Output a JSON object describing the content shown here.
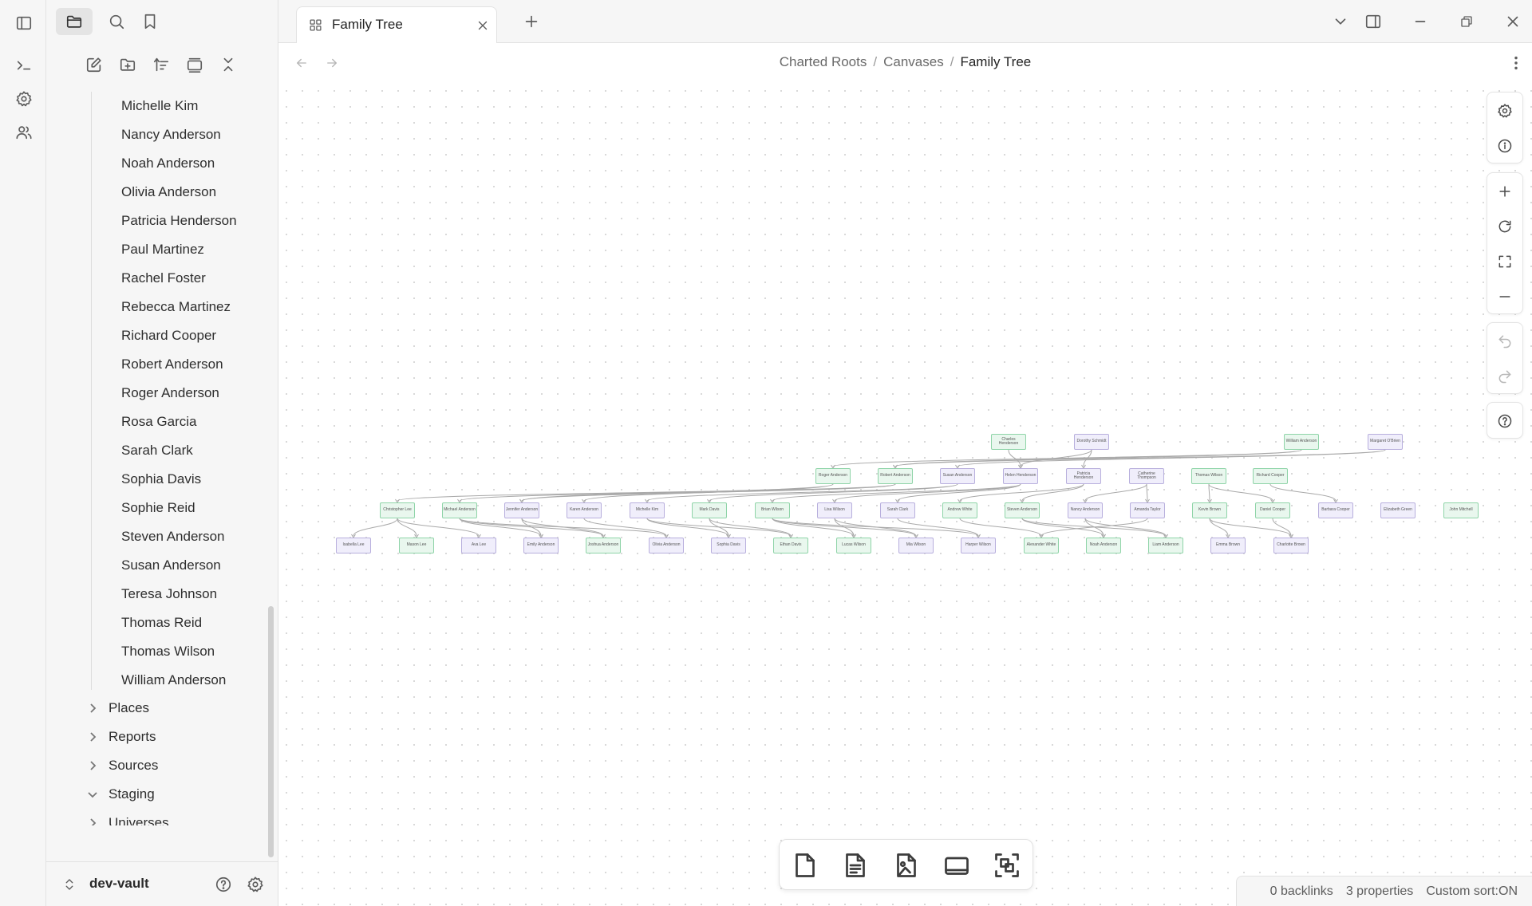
{
  "ribbon": {
    "icons": [
      "sidebar-toggle-icon",
      "terminal-icon",
      "settings-icon",
      "people-icon"
    ]
  },
  "sidebar": {
    "top_icons": [
      "folder-icon",
      "search-icon",
      "bookmark-icon"
    ],
    "toolbar_icons": [
      "new-note-icon",
      "new-folder-icon",
      "sort-icon",
      "collapse-view-icon",
      "collapse-all-icon"
    ],
    "people": [
      "Michelle Kim",
      "Nancy Anderson",
      "Noah Anderson",
      "Olivia Anderson",
      "Patricia Henderson",
      "Paul Martinez",
      "Rachel Foster",
      "Rebecca Martinez",
      "Richard Cooper",
      "Robert Anderson",
      "Roger Anderson",
      "Rosa Garcia",
      "Sarah Clark",
      "Sophia Davis",
      "Sophie Reid",
      "Steven Anderson",
      "Susan Anderson",
      "Teresa Johnson",
      "Thomas Reid",
      "Thomas Wilson",
      "William Anderson"
    ],
    "folders": [
      {
        "label": "Places",
        "expanded": false
      },
      {
        "label": "Reports",
        "expanded": false
      },
      {
        "label": "Sources",
        "expanded": false
      },
      {
        "label": "Staging",
        "expanded": true
      },
      {
        "label": "Universes",
        "expanded": false
      }
    ],
    "vault_name": "dev-vault"
  },
  "tab": {
    "title": "Family Tree",
    "icon": "canvas-icon"
  },
  "breadcrumb": {
    "part1": "Charted Roots",
    "part2": "Canvases",
    "current": "Family Tree"
  },
  "status": {
    "backlinks": "0 backlinks",
    "properties": "3 properties",
    "sort": "Custom sort:ON"
  },
  "colors": {
    "male_fill": "#e9f7ee",
    "male_border": "#8fd4a8",
    "female_fill": "#f0eefb",
    "female_border": "#b8afdd"
  },
  "tree": {
    "generations": [
      [
        {
          "name": "Charles Henderson",
          "g": "m"
        },
        {
          "name": "Dorothy Schmidt",
          "g": "f"
        },
        {
          "name": "William Anderson",
          "g": "m"
        },
        {
          "name": "Margaret O'Brien",
          "g": "f"
        }
      ],
      [
        {
          "name": "Roger Anderson",
          "g": "m"
        },
        {
          "name": "Robert Anderson",
          "g": "m"
        },
        {
          "name": "Susan Anderson",
          "g": "f"
        },
        {
          "name": "Helen Henderson",
          "g": "f"
        },
        {
          "name": "Patricia Henderson",
          "g": "f"
        },
        {
          "name": "Catherine Thompson",
          "g": "f"
        },
        {
          "name": "Thomas Wilson",
          "g": "m"
        },
        {
          "name": "Richard Cooper",
          "g": "m"
        }
      ],
      [
        {
          "name": "Christopher Lee",
          "g": "m"
        },
        {
          "name": "Michael Anderson",
          "g": "m"
        },
        {
          "name": "Jennifer Anderson",
          "g": "f"
        },
        {
          "name": "Karen Anderson",
          "g": "f"
        },
        {
          "name": "Michelle Kim",
          "g": "f"
        },
        {
          "name": "Mark Davis",
          "g": "m"
        },
        {
          "name": "Brian Wilson",
          "g": "m"
        },
        {
          "name": "Lisa Wilson",
          "g": "f"
        },
        {
          "name": "Sarah Clark",
          "g": "f"
        },
        {
          "name": "Andrew White",
          "g": "m"
        },
        {
          "name": "Steven Anderson",
          "g": "m"
        },
        {
          "name": "Nancy Anderson",
          "g": "f"
        },
        {
          "name": "Amanda Taylor",
          "g": "f"
        },
        {
          "name": "Kevin Brown",
          "g": "m"
        },
        {
          "name": "Daniel Cooper",
          "g": "m"
        },
        {
          "name": "Barbara Cooper",
          "g": "f"
        },
        {
          "name": "Elizabeth Green",
          "g": "f"
        },
        {
          "name": "John Mitchell",
          "g": "m"
        }
      ],
      [
        {
          "name": "Isabella Lee",
          "g": "f"
        },
        {
          "name": "Mason Lee",
          "g": "m"
        },
        {
          "name": "Ava Lee",
          "g": "f"
        },
        {
          "name": "Emily Anderson",
          "g": "f"
        },
        {
          "name": "Joshua Anderson",
          "g": "m"
        },
        {
          "name": "Olivia Anderson",
          "g": "f"
        },
        {
          "name": "Sophia Davis",
          "g": "f"
        },
        {
          "name": "Ethan Davis",
          "g": "m"
        },
        {
          "name": "Lucas Wilson",
          "g": "m"
        },
        {
          "name": "Mia Wilson",
          "g": "f"
        },
        {
          "name": "Harper Wilson",
          "g": "f"
        },
        {
          "name": "Alexander White",
          "g": "m"
        },
        {
          "name": "Noah Anderson",
          "g": "m"
        },
        {
          "name": "Liam Anderson",
          "g": "m"
        },
        {
          "name": "Emma Brown",
          "g": "f"
        },
        {
          "name": "Charlotte Brown",
          "g": "f"
        }
      ]
    ]
  }
}
